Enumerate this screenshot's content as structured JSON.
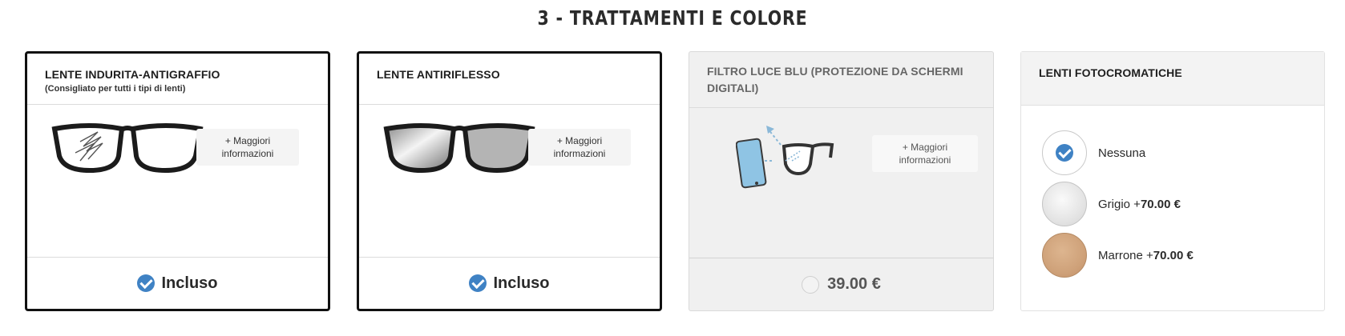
{
  "section": {
    "title": "3 - TRATTAMENTI E COLORE"
  },
  "cards": [
    {
      "title": "LENTE INDURITA-ANTIGRAFFIO",
      "subtitle": "(Consigliato per tutti i tipi di lenti)",
      "more_line1": "+ Maggiori",
      "more_line2": "informazioni",
      "footer": "Incluso",
      "state": "selected",
      "icon": "scratch-resistant-glasses-icon"
    },
    {
      "title": "LENTE ANTIRIFLESSO",
      "more_line1": "+ Maggiori",
      "more_line2": "informazioni",
      "footer": "Incluso",
      "state": "selected",
      "icon": "anti-reflective-glasses-icon"
    },
    {
      "title": "FILTRO LUCE BLU (PROTEZIONE DA SCHERMI DIGITALI)",
      "more_line1": "+ Maggiori",
      "more_line2": "informazioni",
      "footer": "39.00 €",
      "state": "unselected",
      "icon": "blue-light-filter-icon"
    }
  ],
  "photochromic": {
    "title": "LENTI FOTOCROMATICHE",
    "options": [
      {
        "label": "Nessuna",
        "price": "",
        "selected": true,
        "color": "#ffffff"
      },
      {
        "label": "Grigio +",
        "price": "70.00 €",
        "selected": false,
        "color": "#e2e2e2"
      },
      {
        "label": "Marrone +",
        "price": "70.00 €",
        "selected": false,
        "color": "#d0a47c"
      }
    ]
  },
  "colors": {
    "accent": "#3f82c4",
    "selected_border": "#111111",
    "disabled_bg": "#f0f0f0"
  }
}
